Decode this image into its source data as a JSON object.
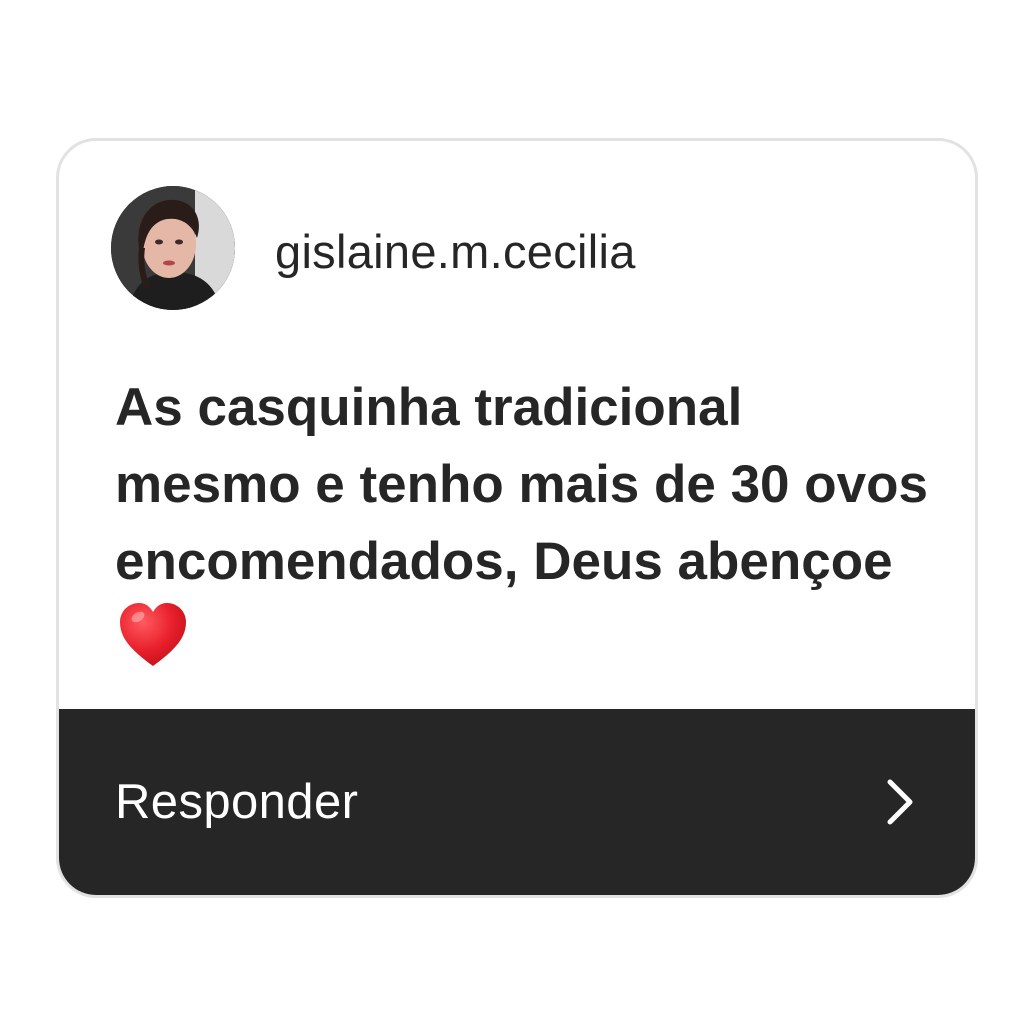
{
  "comment": {
    "username": "gislaine.m.cecilia",
    "text": "As casquinha tradicional mesmo e tenho mais de 30 ovos encomendados, Deus abençoe",
    "emoji": "heart-icon",
    "reply_label": "Responder",
    "reply_icon": "chevron-right-icon"
  },
  "colors": {
    "text": "#262626",
    "reply_bar_bg": "#262626",
    "reply_text": "#ffffff",
    "heart": "#e8202b",
    "card_border": "#e2e2e2"
  }
}
